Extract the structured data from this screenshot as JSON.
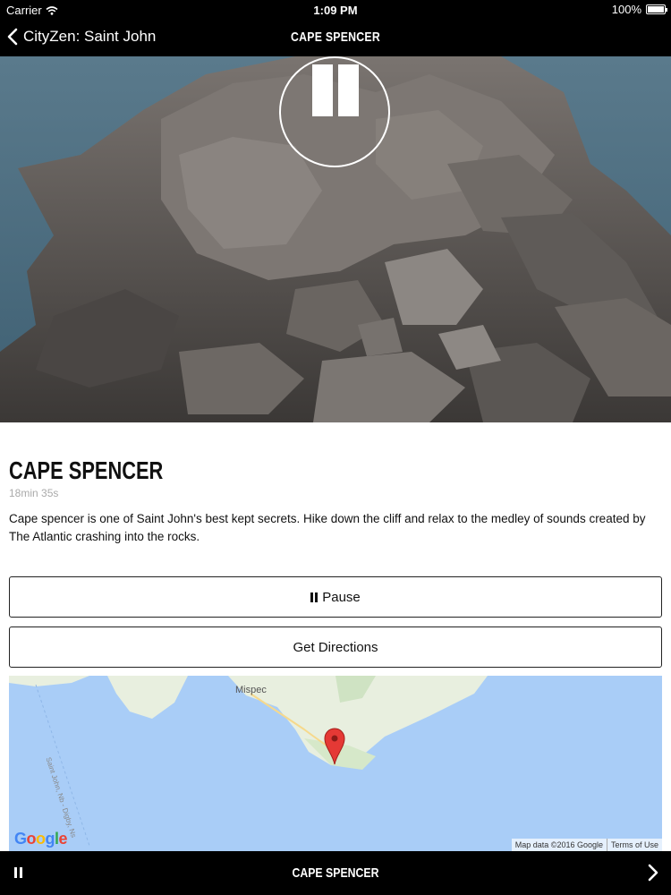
{
  "status_bar": {
    "carrier": "Carrier",
    "time": "1:09 PM",
    "battery": "100%"
  },
  "nav": {
    "back_label": "CityZen: Saint John",
    "title": "CAPE SPENCER"
  },
  "hero": {
    "playback_state": "playing"
  },
  "content": {
    "title": "CAPE SPENCER",
    "duration": "18min 35s",
    "description": "Cape spencer is one of Saint John's best kept secrets. Hike down the cliff and relax to the medley of sounds created by The Atlantic crashing into the rocks."
  },
  "buttons": {
    "pause_label": "Pause",
    "directions_label": "Get Directions"
  },
  "map": {
    "place_label": "Mispec",
    "road_label": "Saint John, Nb - Digby, Ns",
    "logo_letters": [
      "G",
      "o",
      "o",
      "g",
      "l",
      "e"
    ],
    "attribution": "Map data ©2016 Google",
    "terms": "Terms of Use",
    "colors": {
      "water": "#a9cdf7",
      "land": "#e8efdf",
      "marker": "#e53935"
    }
  },
  "player": {
    "title": "CAPE SPENCER"
  },
  "icons": {
    "wifi": "wifi-icon",
    "back": "chevron-left-icon",
    "pause": "pause-icon",
    "marker": "map-marker-icon",
    "next": "chevron-right-icon"
  }
}
